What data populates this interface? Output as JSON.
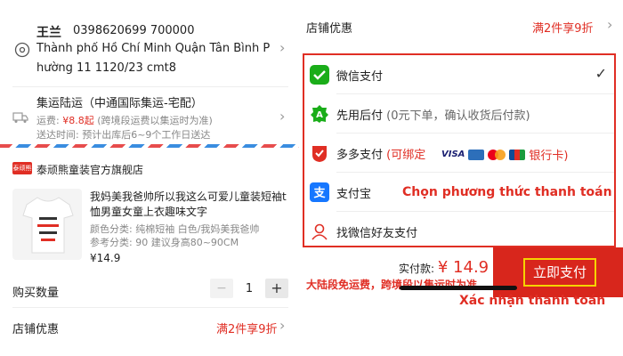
{
  "address": {
    "name": "王兰",
    "phone": "0398620699  700000",
    "line1": "Thành phố Hồ Chí Minh Quận Tân Bình P",
    "line2": "hường 11 1120/23 cmt8"
  },
  "shipping": {
    "title": "集运陆运（中通国际集运-宅配）",
    "fee_label": "运费: ",
    "fee_price": "¥8.8起",
    "fee_note": " (跨境段运费以集运时为准)",
    "eta": "送达时间:  预计出库后6~9个工作日送达"
  },
  "shop": {
    "badge": "泰顽熊",
    "name": "泰顽熊童装官方旗舰店"
  },
  "product": {
    "title": "我妈美我爸帅所以我这么可爱儿童装短袖t恤男童女童上衣趣味文字",
    "spec": "颜色分类: 纯棉短袖 白色/我妈美我爸帅",
    "ref": "参考分类: 90 建议身高80~90CM",
    "price": "¥14.9"
  },
  "quantity": {
    "label": "购买数量",
    "minus": "−",
    "value": "1",
    "plus": "+"
  },
  "discount": {
    "label": "店铺优惠",
    "value": "满2件享9折"
  },
  "payment": {
    "wechat": "微信支付",
    "later": "先用后付",
    "later_sub": "(0元下单，确认收货后付款)",
    "duoduo": "多多支付",
    "duoduo_sub": "(可绑定",
    "visa": "VISA",
    "bank": "银行卡)",
    "alipay": "支付宝",
    "friend": "找微信好友支付",
    "annotation": "Chọn phương thức thanh toán",
    "selected_mark": "✓"
  },
  "footer": {
    "total_label": "实付款: ",
    "total_amount": "¥ 14.9",
    "free_note": "大陆段免运费，跨境段以集运时为准",
    "pay_button": "立即支付",
    "annotation": "Xác nhận thanh toán"
  },
  "colors": {
    "accent": "#e02e24",
    "wechat_green": "#1aad19",
    "alipay_blue": "#1677ff",
    "highlight_yellow": "#f5d400"
  }
}
